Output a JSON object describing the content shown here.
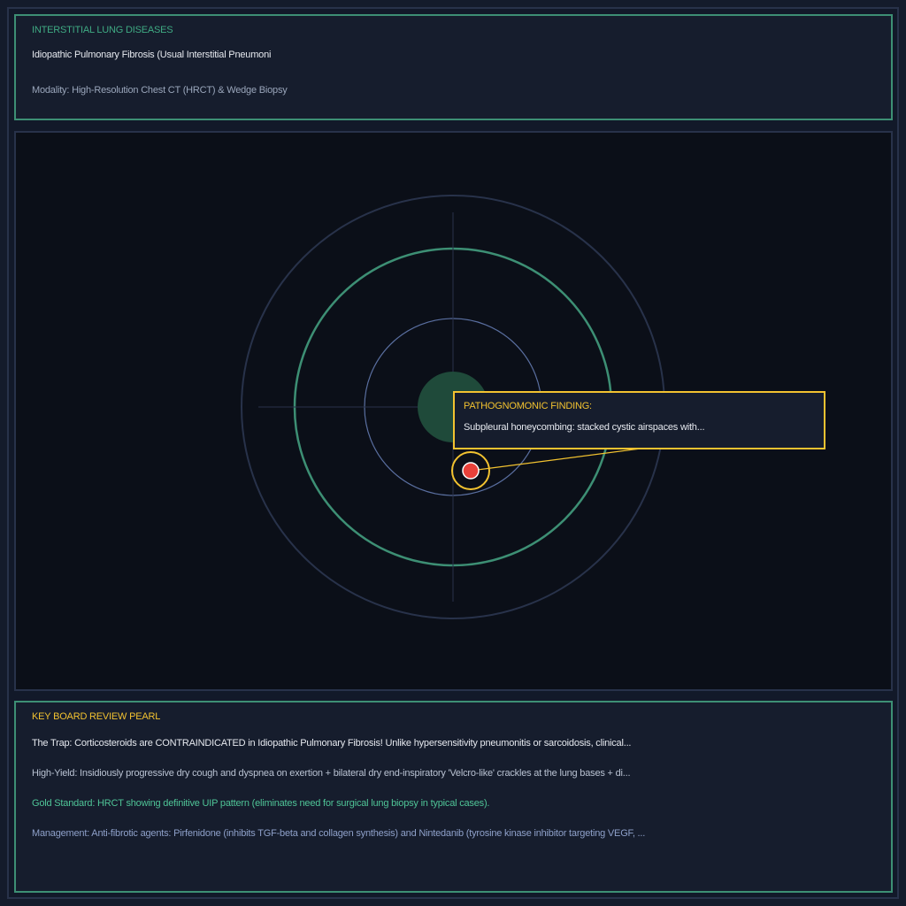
{
  "header": {
    "category": "INTERSTITIAL LUNG DISEASES",
    "diagnosis": "Idiopathic Pulmonary Fibrosis (Usual Interstitial Pneumoni",
    "modality": "Modality: High-Resolution Chest CT (HRCT) & Wedge Biopsy"
  },
  "callout": {
    "title": "PATHOGNOMONIC FINDING:",
    "body": "Subpleural honeycombing: stacked cystic airspaces with..."
  },
  "pearl": {
    "heading": "KEY BOARD REVIEW PEARL",
    "trap": "The Trap: Corticosteroids are CONTRAINDICATED in Idiopathic Pulmonary Fibrosis! Unlike hypersensitivity pneumonitis or sarcoidosis, clinical...",
    "high_yield": "High-Yield: Insidiously progressive dry cough and dyspnea on exertion + bilateral dry end-inspiratory 'Velcro-like' crackles at the lung bases + di...",
    "gold_standard": "Gold Standard: HRCT showing definitive UIP pattern (eliminates need for surgical lung biopsy in typical cases).",
    "management": "Management: Anti-fibrotic agents: Pirfenidone (inhibits TGF-beta and collagen synthesis) and Nintedanib (tyrosine kinase inhibitor targeting VEGF, ..."
  },
  "colors": {
    "accent_green": "#3d8f74",
    "accent_yellow": "#f2c230",
    "marker_red": "#e8413a",
    "ring_blue": "#5a6fa0",
    "core_green": "#1f4a3a"
  },
  "icons": {
    "marker": "target-marker-icon"
  }
}
